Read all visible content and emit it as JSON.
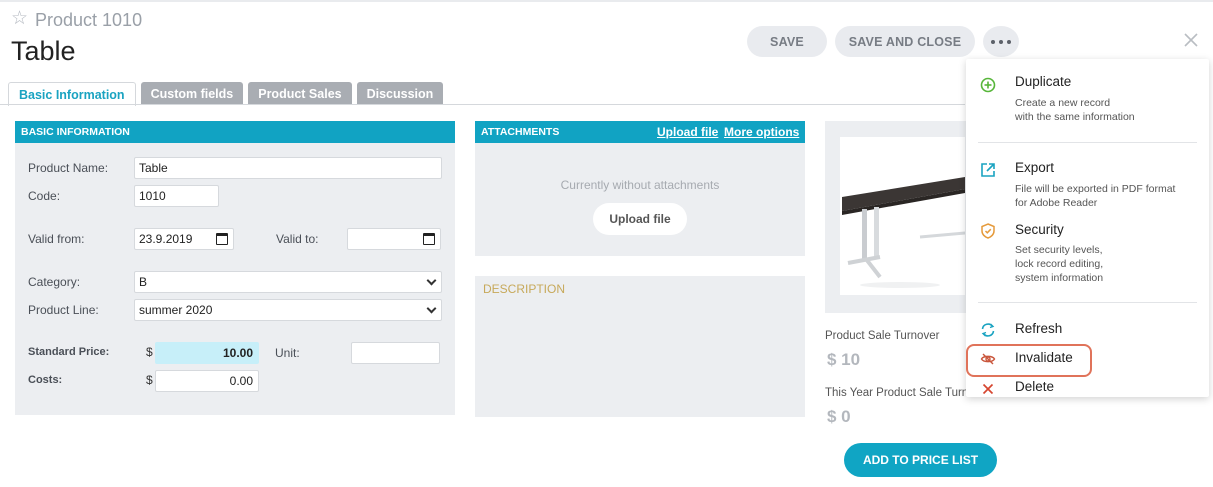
{
  "header": {
    "subtitle": "Product 1010",
    "title": "Table",
    "save_label": "SAVE",
    "save_close_label": "SAVE AND CLOSE"
  },
  "tabs": [
    {
      "label": "Basic Information",
      "active": true
    },
    {
      "label": "Custom fields",
      "active": false
    },
    {
      "label": "Product Sales",
      "active": false
    },
    {
      "label": "Discussion",
      "active": false
    }
  ],
  "basic": {
    "heading": "BASIC INFORMATION",
    "product_name_label": "Product Name:",
    "product_name_value": "Table",
    "code_label": "Code:",
    "code_value": "1010",
    "valid_from_label": "Valid from:",
    "valid_from_value": "23.9.2019",
    "valid_to_label": "Valid to:",
    "valid_to_value": "",
    "category_label": "Category:",
    "category_value": "B",
    "product_line_label": "Product Line:",
    "product_line_value": "summer 2020",
    "standard_price_label": "Standard Price:",
    "currency": "$",
    "standard_price_value": "10.00",
    "unit_label": "Unit:",
    "unit_value": "",
    "costs_label": "Costs:",
    "costs_value": "0.00"
  },
  "attachments": {
    "heading": "ATTACHMENTS",
    "upload_link": "Upload file",
    "more_link": "More options",
    "empty_message": "Currently without attachments",
    "upload_button": "Upload file"
  },
  "description": {
    "heading": "DESCRIPTION"
  },
  "kpis": {
    "turnover_label": "Product Sale Turnover",
    "turnover_value": "$ 10",
    "year_turnover_label": "This Year Product Sale Turno",
    "year_turnover_value": "$ 0"
  },
  "price_button": "ADD TO PRICE LIST",
  "menu": {
    "items": [
      {
        "title": "Duplicate",
        "desc": "Create a new record\nwith the same information",
        "icon": "plus-circle-icon"
      },
      {
        "title": "Export",
        "desc": "File will be exported in PDF format\nfor Adobe Reader",
        "icon": "export-icon"
      },
      {
        "title": "Security",
        "desc": "Set security levels,\nlock record editing,\nsystem information",
        "icon": "shield-icon"
      },
      {
        "title": "Refresh",
        "desc": "",
        "icon": "refresh-icon"
      },
      {
        "title": "Invalidate",
        "desc": "",
        "icon": "eye-slash-icon"
      },
      {
        "title": "Delete",
        "desc": "",
        "icon": "delete-x-icon"
      }
    ]
  },
  "colors": {
    "accent": "#11a3c3",
    "highlight_ring": "#e0735a",
    "panel_bg": "#eceef1"
  }
}
